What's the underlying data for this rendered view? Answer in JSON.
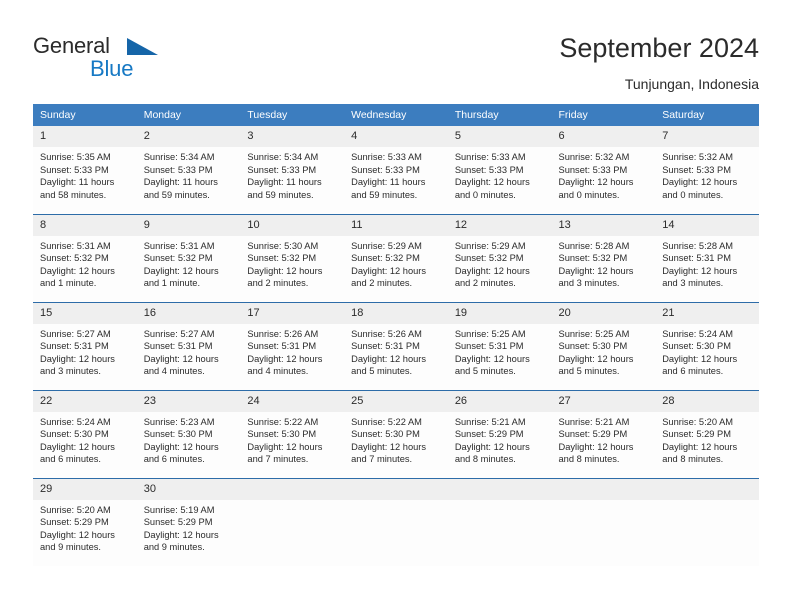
{
  "brand": {
    "name_part1": "General",
    "name_part2": "Blue",
    "triangle_color": "#1565a8",
    "blue_text_color": "#1779c4"
  },
  "header": {
    "title": "September 2024",
    "subtitle": "Tunjungan, Indonesia"
  },
  "theme": {
    "header_bg": "#3c7dbf",
    "week_divider": "#2d6ca8",
    "daynum_bg": "#efefef",
    "cell_bg": "#fdfdfd",
    "text": "#2b2b2b"
  },
  "weekday_headers": [
    "Sunday",
    "Monday",
    "Tuesday",
    "Wednesday",
    "Thursday",
    "Friday",
    "Saturday"
  ],
  "labels": {
    "sunrise_prefix": "Sunrise:",
    "sunset_prefix": "Sunset:",
    "daylight_prefix": "Daylight:"
  },
  "weeks": [
    [
      {
        "day": "1",
        "sunrise": "Sunrise: 5:35 AM",
        "sunset": "Sunset: 5:33 PM",
        "daylight": "Daylight: 11 hours and 58 minutes."
      },
      {
        "day": "2",
        "sunrise": "Sunrise: 5:34 AM",
        "sunset": "Sunset: 5:33 PM",
        "daylight": "Daylight: 11 hours and 59 minutes."
      },
      {
        "day": "3",
        "sunrise": "Sunrise: 5:34 AM",
        "sunset": "Sunset: 5:33 PM",
        "daylight": "Daylight: 11 hours and 59 minutes."
      },
      {
        "day": "4",
        "sunrise": "Sunrise: 5:33 AM",
        "sunset": "Sunset: 5:33 PM",
        "daylight": "Daylight: 11 hours and 59 minutes."
      },
      {
        "day": "5",
        "sunrise": "Sunrise: 5:33 AM",
        "sunset": "Sunset: 5:33 PM",
        "daylight": "Daylight: 12 hours and 0 minutes."
      },
      {
        "day": "6",
        "sunrise": "Sunrise: 5:32 AM",
        "sunset": "Sunset: 5:33 PM",
        "daylight": "Daylight: 12 hours and 0 minutes."
      },
      {
        "day": "7",
        "sunrise": "Sunrise: 5:32 AM",
        "sunset": "Sunset: 5:33 PM",
        "daylight": "Daylight: 12 hours and 0 minutes."
      }
    ],
    [
      {
        "day": "8",
        "sunrise": "Sunrise: 5:31 AM",
        "sunset": "Sunset: 5:32 PM",
        "daylight": "Daylight: 12 hours and 1 minute."
      },
      {
        "day": "9",
        "sunrise": "Sunrise: 5:31 AM",
        "sunset": "Sunset: 5:32 PM",
        "daylight": "Daylight: 12 hours and 1 minute."
      },
      {
        "day": "10",
        "sunrise": "Sunrise: 5:30 AM",
        "sunset": "Sunset: 5:32 PM",
        "daylight": "Daylight: 12 hours and 2 minutes."
      },
      {
        "day": "11",
        "sunrise": "Sunrise: 5:29 AM",
        "sunset": "Sunset: 5:32 PM",
        "daylight": "Daylight: 12 hours and 2 minutes."
      },
      {
        "day": "12",
        "sunrise": "Sunrise: 5:29 AM",
        "sunset": "Sunset: 5:32 PM",
        "daylight": "Daylight: 12 hours and 2 minutes."
      },
      {
        "day": "13",
        "sunrise": "Sunrise: 5:28 AM",
        "sunset": "Sunset: 5:32 PM",
        "daylight": "Daylight: 12 hours and 3 minutes."
      },
      {
        "day": "14",
        "sunrise": "Sunrise: 5:28 AM",
        "sunset": "Sunset: 5:31 PM",
        "daylight": "Daylight: 12 hours and 3 minutes."
      }
    ],
    [
      {
        "day": "15",
        "sunrise": "Sunrise: 5:27 AM",
        "sunset": "Sunset: 5:31 PM",
        "daylight": "Daylight: 12 hours and 3 minutes."
      },
      {
        "day": "16",
        "sunrise": "Sunrise: 5:27 AM",
        "sunset": "Sunset: 5:31 PM",
        "daylight": "Daylight: 12 hours and 4 minutes."
      },
      {
        "day": "17",
        "sunrise": "Sunrise: 5:26 AM",
        "sunset": "Sunset: 5:31 PM",
        "daylight": "Daylight: 12 hours and 4 minutes."
      },
      {
        "day": "18",
        "sunrise": "Sunrise: 5:26 AM",
        "sunset": "Sunset: 5:31 PM",
        "daylight": "Daylight: 12 hours and 5 minutes."
      },
      {
        "day": "19",
        "sunrise": "Sunrise: 5:25 AM",
        "sunset": "Sunset: 5:31 PM",
        "daylight": "Daylight: 12 hours and 5 minutes."
      },
      {
        "day": "20",
        "sunrise": "Sunrise: 5:25 AM",
        "sunset": "Sunset: 5:30 PM",
        "daylight": "Daylight: 12 hours and 5 minutes."
      },
      {
        "day": "21",
        "sunrise": "Sunrise: 5:24 AM",
        "sunset": "Sunset: 5:30 PM",
        "daylight": "Daylight: 12 hours and 6 minutes."
      }
    ],
    [
      {
        "day": "22",
        "sunrise": "Sunrise: 5:24 AM",
        "sunset": "Sunset: 5:30 PM",
        "daylight": "Daylight: 12 hours and 6 minutes."
      },
      {
        "day": "23",
        "sunrise": "Sunrise: 5:23 AM",
        "sunset": "Sunset: 5:30 PM",
        "daylight": "Daylight: 12 hours and 6 minutes."
      },
      {
        "day": "24",
        "sunrise": "Sunrise: 5:22 AM",
        "sunset": "Sunset: 5:30 PM",
        "daylight": "Daylight: 12 hours and 7 minutes."
      },
      {
        "day": "25",
        "sunrise": "Sunrise: 5:22 AM",
        "sunset": "Sunset: 5:30 PM",
        "daylight": "Daylight: 12 hours and 7 minutes."
      },
      {
        "day": "26",
        "sunrise": "Sunrise: 5:21 AM",
        "sunset": "Sunset: 5:29 PM",
        "daylight": "Daylight: 12 hours and 8 minutes."
      },
      {
        "day": "27",
        "sunrise": "Sunrise: 5:21 AM",
        "sunset": "Sunset: 5:29 PM",
        "daylight": "Daylight: 12 hours and 8 minutes."
      },
      {
        "day": "28",
        "sunrise": "Sunrise: 5:20 AM",
        "sunset": "Sunset: 5:29 PM",
        "daylight": "Daylight: 12 hours and 8 minutes."
      }
    ],
    [
      {
        "day": "29",
        "sunrise": "Sunrise: 5:20 AM",
        "sunset": "Sunset: 5:29 PM",
        "daylight": "Daylight: 12 hours and 9 minutes."
      },
      {
        "day": "30",
        "sunrise": "Sunrise: 5:19 AM",
        "sunset": "Sunset: 5:29 PM",
        "daylight": "Daylight: 12 hours and 9 minutes."
      },
      {
        "day": "",
        "sunrise": "",
        "sunset": "",
        "daylight": ""
      },
      {
        "day": "",
        "sunrise": "",
        "sunset": "",
        "daylight": ""
      },
      {
        "day": "",
        "sunrise": "",
        "sunset": "",
        "daylight": ""
      },
      {
        "day": "",
        "sunrise": "",
        "sunset": "",
        "daylight": ""
      },
      {
        "day": "",
        "sunrise": "",
        "sunset": "",
        "daylight": ""
      }
    ]
  ]
}
